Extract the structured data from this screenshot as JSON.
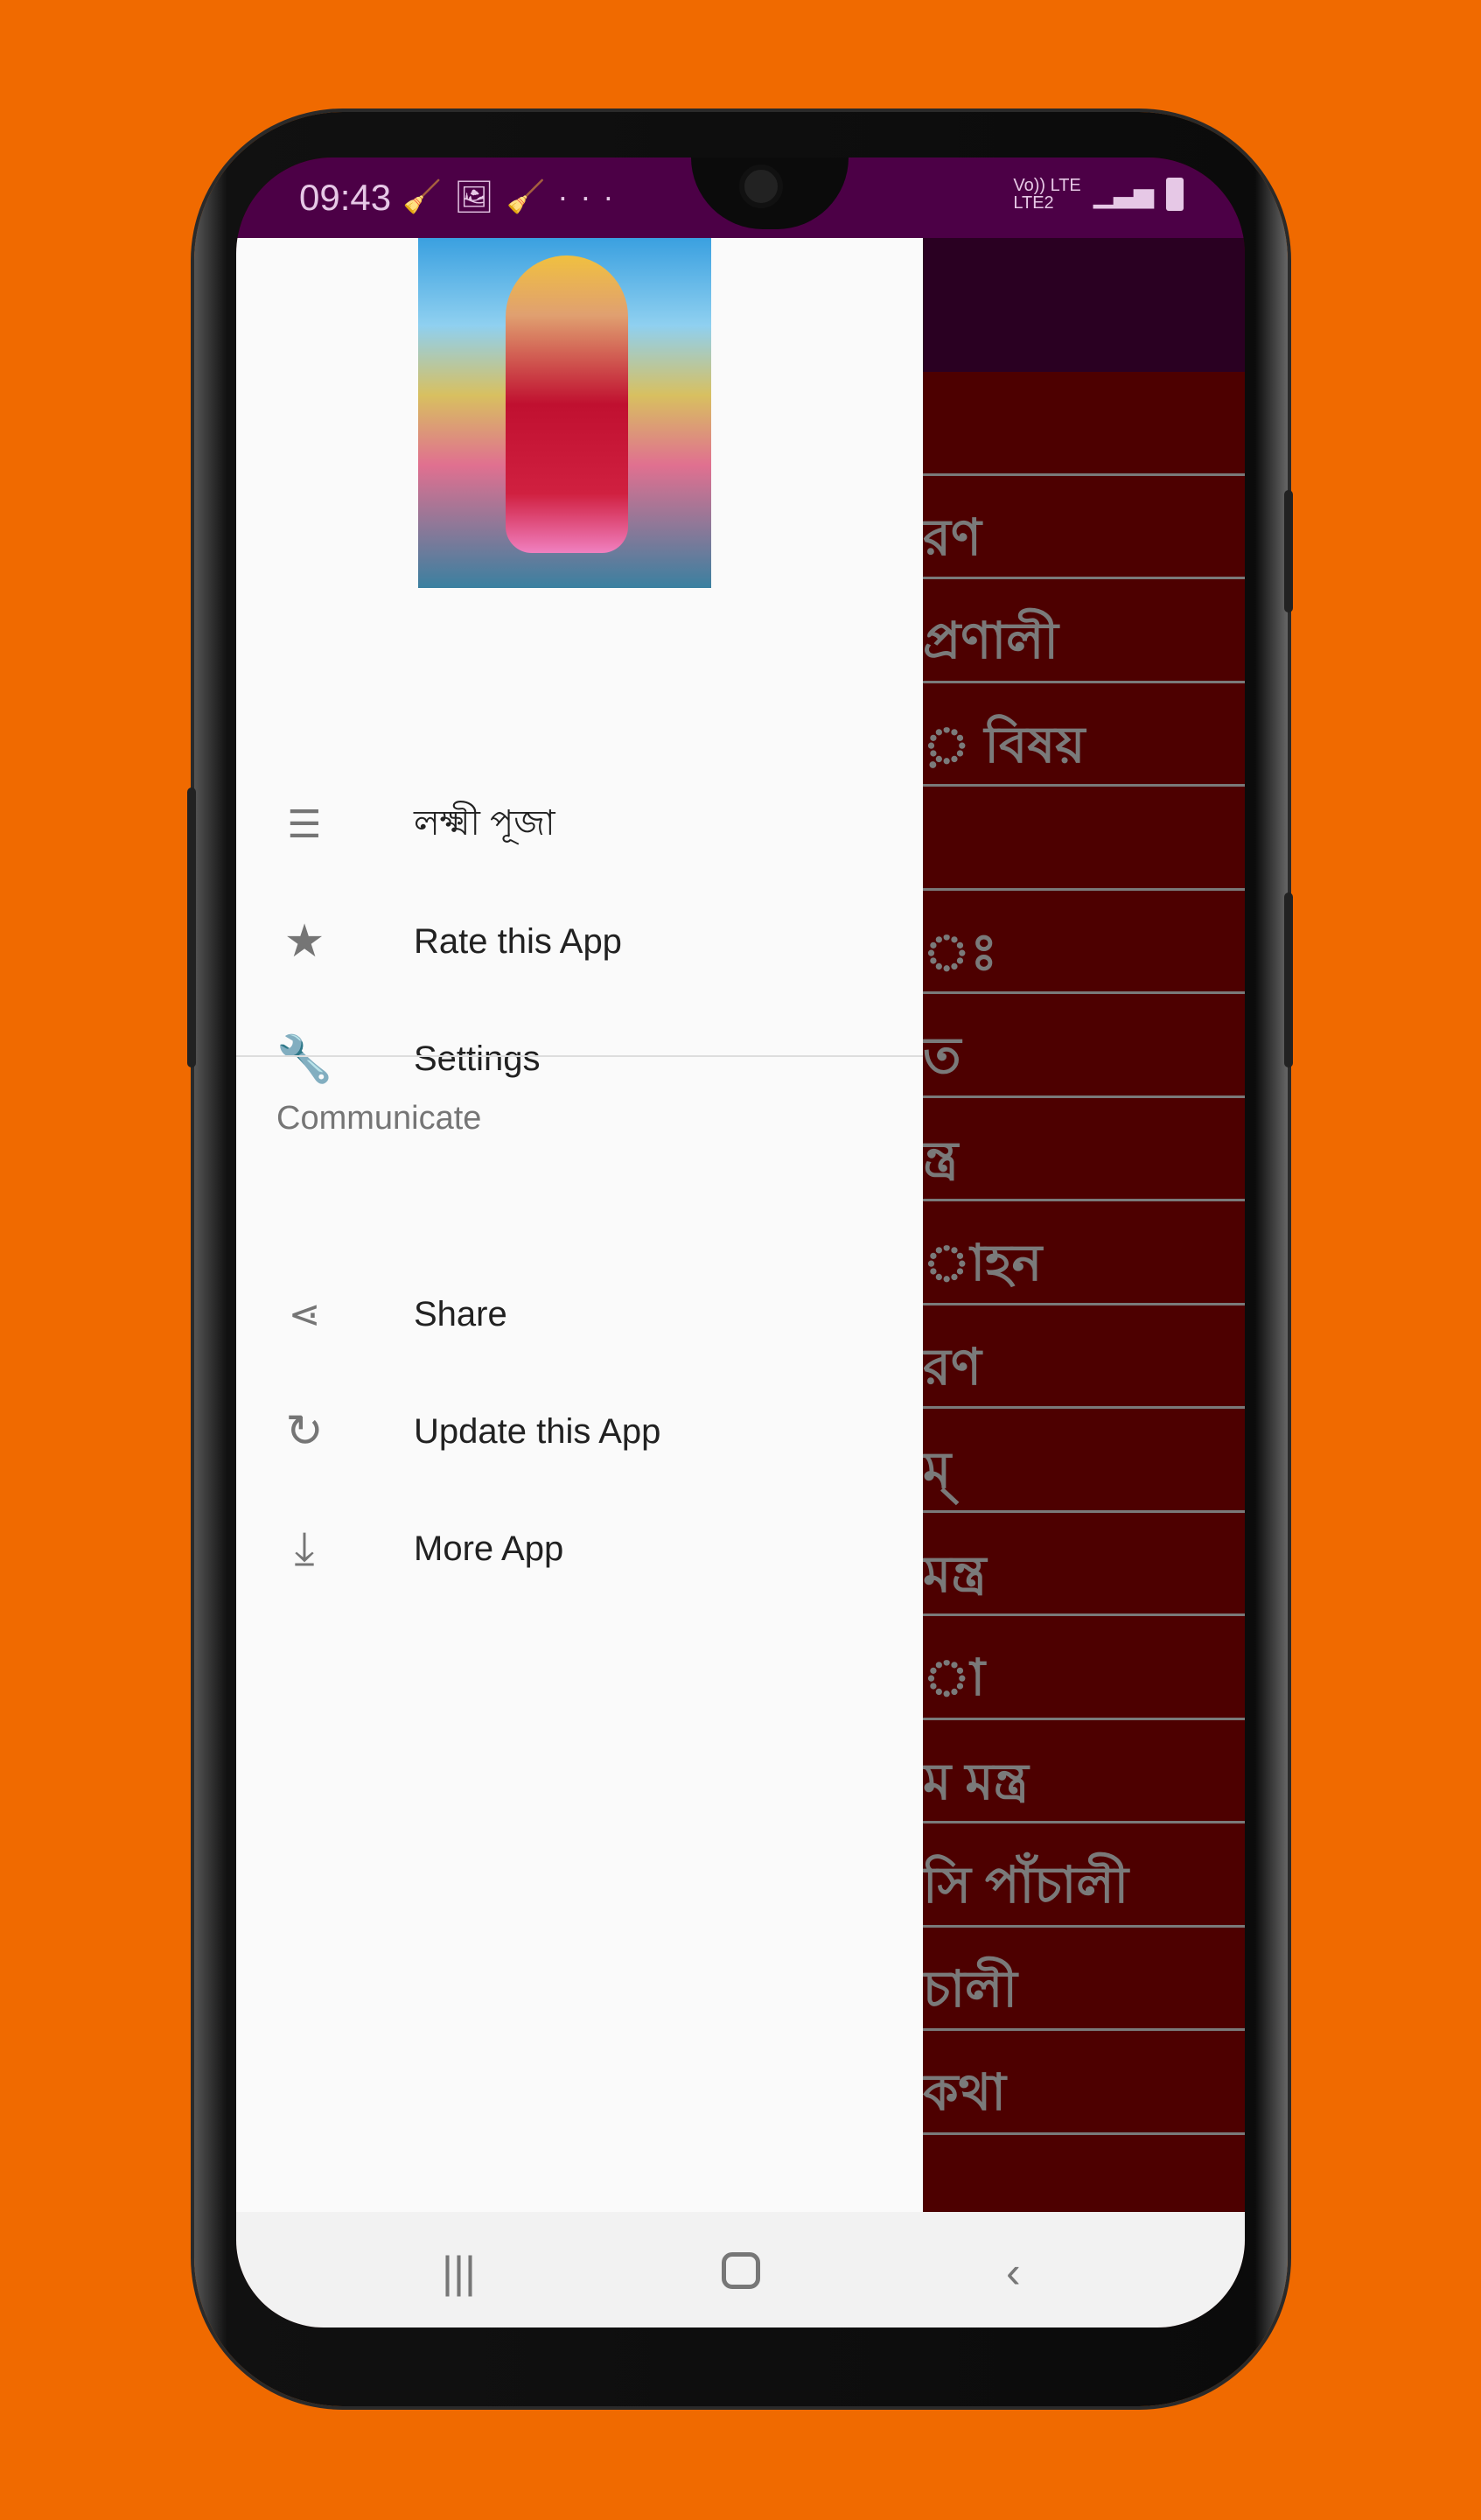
{
  "status_bar": {
    "time": "09:43",
    "icons": [
      "cleaner-icon",
      "image-icon",
      "cleaner-icon",
      "more-dots-icon"
    ],
    "network": "Vo)) LTE",
    "network2": "LTE2",
    "battery": "charging"
  },
  "drawer": {
    "items": [
      {
        "label": "লক্ষ্মী পূজা",
        "icon": "list-icon"
      },
      {
        "label": "Rate this App",
        "icon": "star-icon"
      },
      {
        "label": "Settings",
        "icon": "wrench-icon"
      }
    ],
    "section_title": "Communicate",
    "section_items": [
      {
        "label": "Share",
        "icon": "share-icon"
      },
      {
        "label": "Update this App",
        "icon": "update-icon"
      },
      {
        "label": "More App",
        "icon": "download-icon"
      }
    ]
  },
  "background_list": [
    "",
    "রণ",
    "প্রণালী",
    "় বিষয়",
    "",
    "ঃ",
    "ত",
    "ন্ত্র",
    "াহন",
    "রণ",
    "ম্",
    "মন্ত্র",
    "া",
    "ম মন্ত্র",
    "সি পাঁচালী",
    "চালী",
    "কথা"
  ],
  "colors": {
    "background": "#f06a00",
    "status_bar": "#4c0046",
    "app_bar": "#2a0022",
    "list_bg": "#4d0000",
    "drawer": "#fafafa"
  }
}
